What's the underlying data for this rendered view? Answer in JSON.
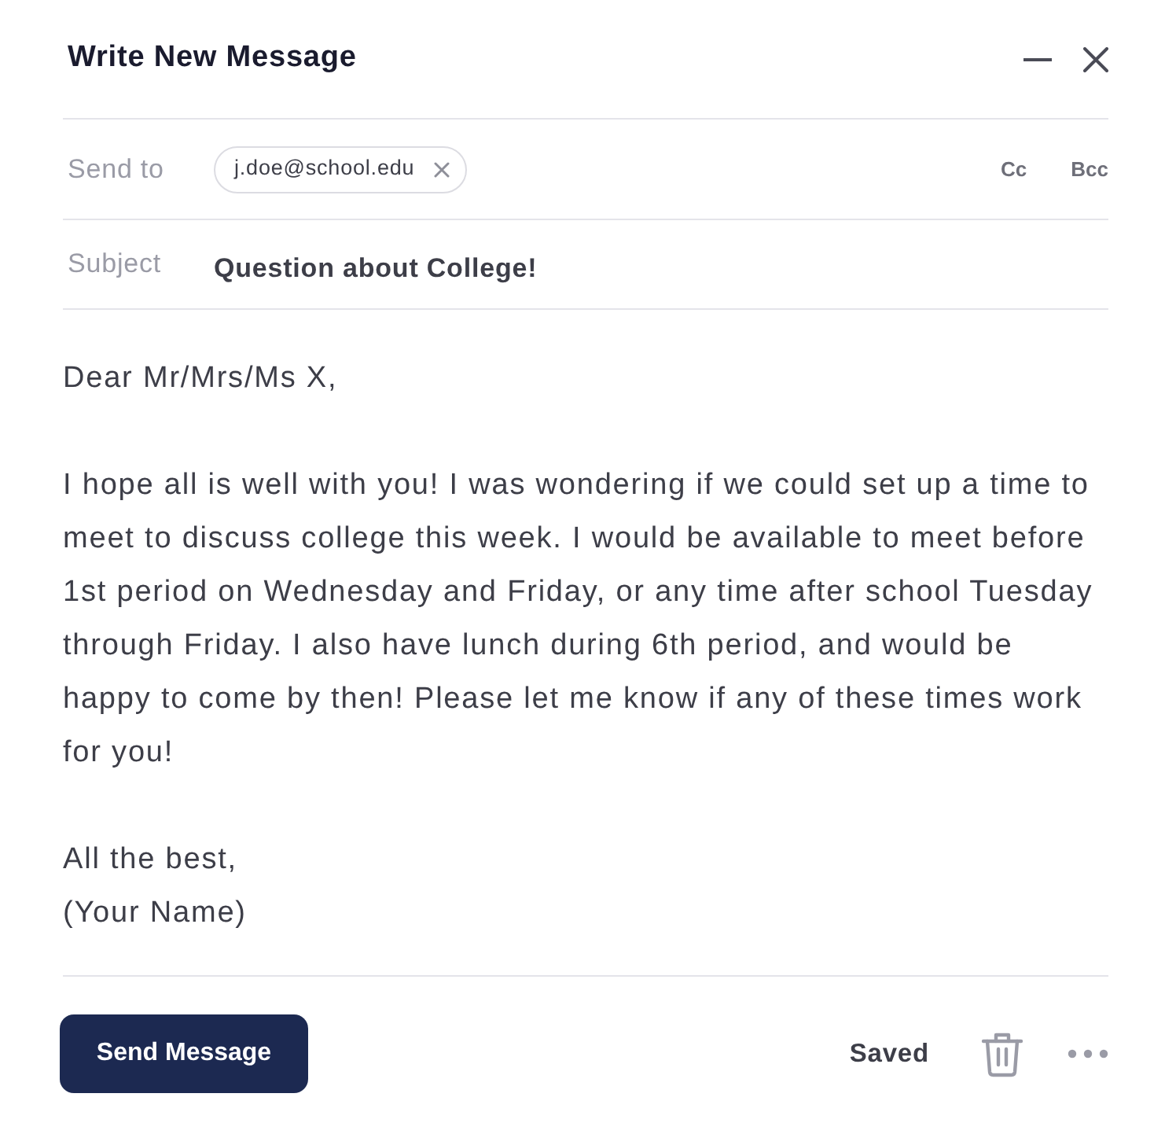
{
  "window": {
    "title": "Write New Message"
  },
  "recipients": {
    "label": "Send to",
    "chips": [
      {
        "address": "j.doe@school.edu"
      }
    ],
    "extra_fields": [
      "Cc",
      "Bcc"
    ]
  },
  "subject": {
    "label": "Subject",
    "value": "Question about College!"
  },
  "body": {
    "paragraphs": [
      [
        "Dear Mr/Mrs/Ms X,"
      ],
      [
        "I hope all is well with you! I was wondering if we could set up a time to meet to discuss college this week. I would be available to meet before 1st period on Wednesday and Friday, or any time after school Tuesday through Friday. I also have lunch during 6th period, and would be happy to come by then! Please let me know if any of these times work for you!"
      ],
      [
        "All the best,",
        "(Your Name)"
      ]
    ]
  },
  "footer": {
    "send_button": "Send Message",
    "save_status": "Saved"
  }
}
